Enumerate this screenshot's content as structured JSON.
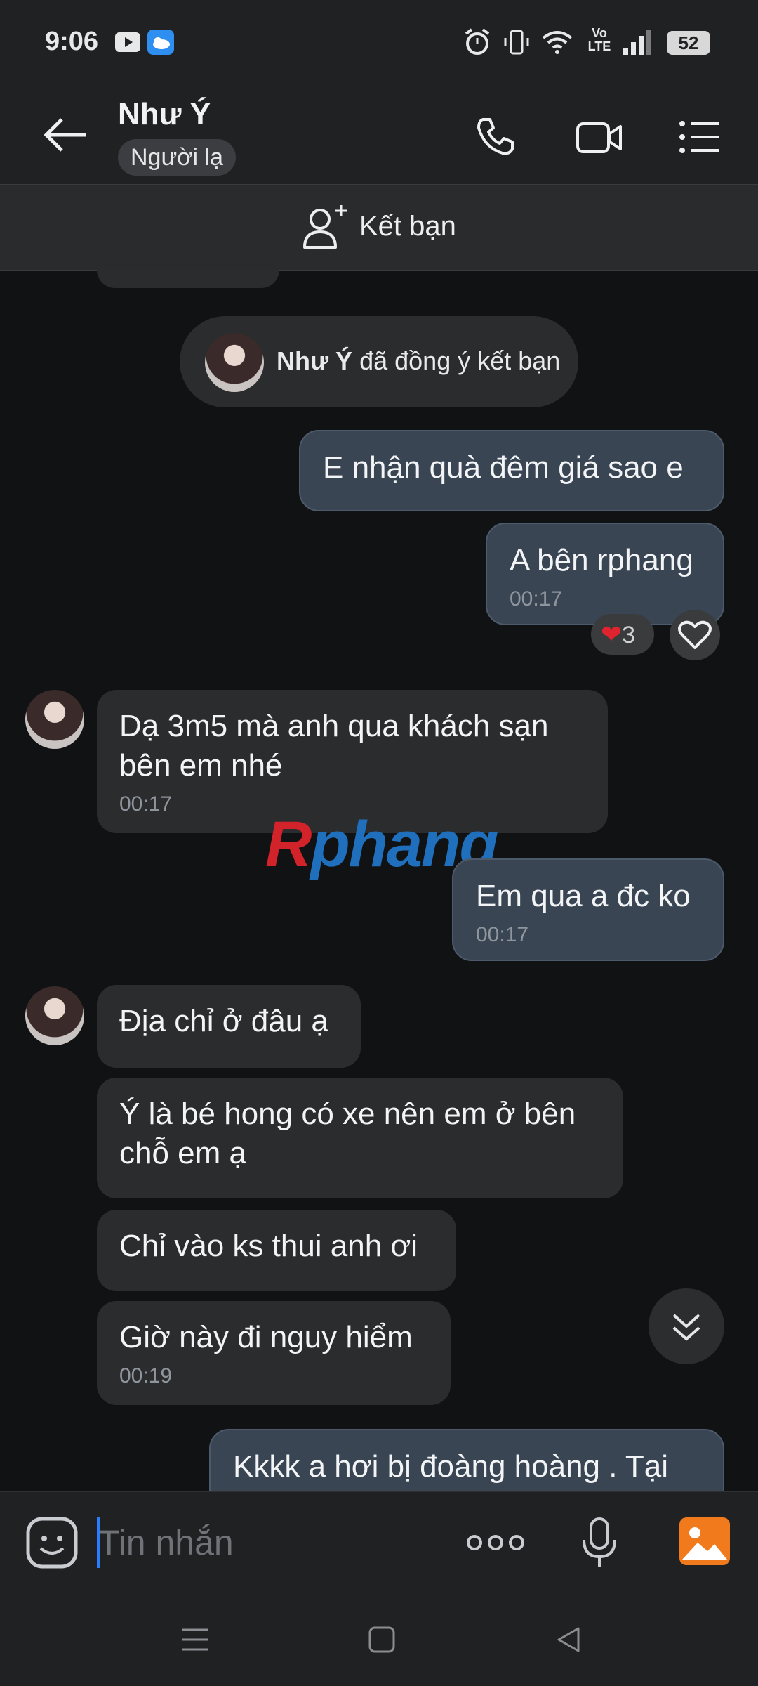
{
  "status_bar": {
    "time": "9:06",
    "battery": "52",
    "network": "Vo LTE"
  },
  "header": {
    "contact_name": "Như Ý",
    "stranger_label": "Người lạ"
  },
  "friend_bar": {
    "add_friend_label": "Kết bạn"
  },
  "notice": {
    "name": "Như Ý",
    "text": " đã đồng ý kết bạn"
  },
  "messages": [
    {
      "dir": "out",
      "text": "E nhận quà đêm giá sao e",
      "time": ""
    },
    {
      "dir": "out",
      "text": "A bên rphang",
      "time": "00:17",
      "reaction_count": "3"
    },
    {
      "dir": "in",
      "text": "Dạ 3m5 mà anh qua khách sạn bên em nhé",
      "time": "00:17"
    },
    {
      "dir": "out",
      "text": "Em qua a đc ko",
      "time": "00:17"
    },
    {
      "dir": "in",
      "text": "Địa chỉ ở đâu ạ",
      "time": ""
    },
    {
      "dir": "in",
      "text": "Ý là bé hong có xe nên em ở bên chỗ em ạ",
      "time": ""
    },
    {
      "dir": "in",
      "text": "Chỉ vào ks thui anh ơi",
      "time": ""
    },
    {
      "dir": "in",
      "text": "Giờ này đi nguy hiểm",
      "time": "00:19"
    },
    {
      "dir": "out",
      "text": "Kkkk a hơi bị đoàng hoàng . Tại",
      "time": ""
    }
  ],
  "watermark": {
    "first": "R",
    "rest": "phang"
  },
  "input": {
    "placeholder": "Tin nhắn"
  },
  "colors": {
    "outgoing_bubble": "#3a4554",
    "incoming_bubble": "#2b2c2e",
    "background": "#111213",
    "accent": "#2b7cff"
  }
}
